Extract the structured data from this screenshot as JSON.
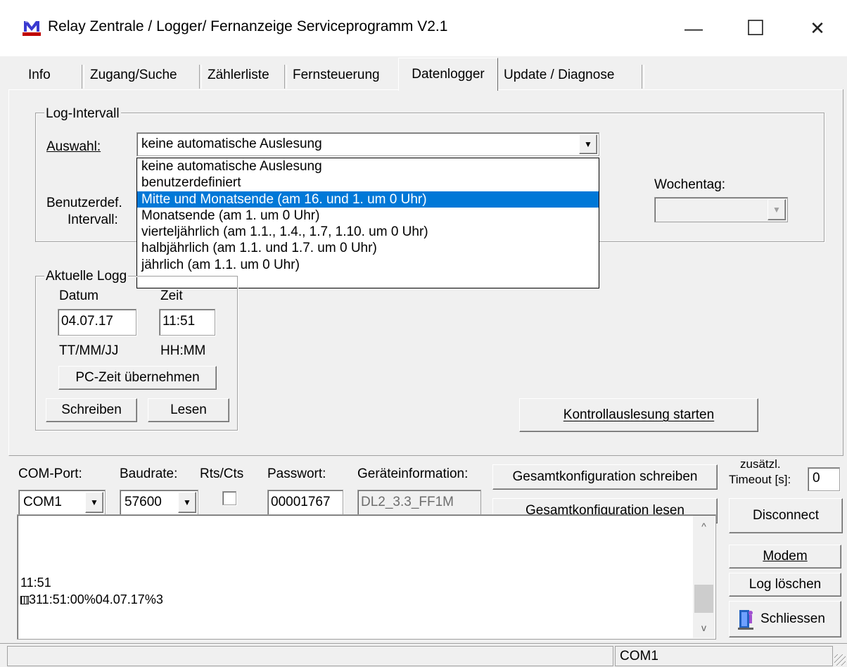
{
  "window": {
    "title": "Relay Zentrale / Logger/ Fernanzeige Serviceprogramm  V2.1",
    "minimize_glyph": "—",
    "maximize_glyph": "☐",
    "close_glyph": "✕",
    "app_icon": "relay-app-icon"
  },
  "tabs": [
    {
      "label": "Info"
    },
    {
      "label": "Zugang/Suche"
    },
    {
      "label": "Zählerliste"
    },
    {
      "label": "Fernsteuerung"
    },
    {
      "label": "Datenlogger"
    },
    {
      "label": "Update / Diagnose"
    }
  ],
  "log_interval": {
    "group_label": "Log-Intervall",
    "auswahl_label": "Auswahl:",
    "selected_value": "keine automatische Auslesung",
    "options": [
      "keine automatische Auslesung",
      "benutzerdefiniert",
      "Mitte und Monatsende (am 16. und 1. um 0 Uhr)",
      "Monatsende (am 1. um 0 Uhr)",
      "vierteljährlich (am 1.1., 1.4., 1.7, 1.10. um 0 Uhr)",
      "halbjährlich (am 1.1. und 1.7. um 0 Uhr)",
      "jährlich (am 1.1. um 0 Uhr)"
    ],
    "highlighted_index": 2,
    "benutzerdef_label_1": "Benutzerdef.",
    "benutzerdef_label_2": "Intervall:",
    "wochentag_label": "Wochentag:",
    "wochentag_value": ""
  },
  "logger_time": {
    "group_label": "Aktuelle Logg",
    "datum_label": "Datum",
    "zeit_label": "Zeit",
    "datum_value": "04.07.17",
    "zeit_value": "11:51",
    "datum_format": "TT/MM/JJ",
    "zeit_format": "HH:MM",
    "pc_time_button": "PC-Zeit übernehmen",
    "write_button": "Schreiben",
    "read_button": "Lesen"
  },
  "kontroll_button": "Kontrollauslesung starten",
  "connection": {
    "com_port_label": "COM-Port:",
    "com_port_value": "COM1",
    "baudrate_label": "Baudrate:",
    "baudrate_value": "57600",
    "rtscts_label": "Rts/Cts",
    "rtscts_checked": false,
    "password_label": "Passwort:",
    "password_value": "00001767",
    "device_info_label": "Geräteinformation:",
    "device_info_value": "DL2_3.3_FF1M",
    "write_all_button": "Gesamtkonfiguration schreiben",
    "read_all_button": "Gesamtkonfiguration lesen",
    "timeout_label_1": "zusätzl.",
    "timeout_label_2": "Timeout [s]:",
    "timeout_value": "0",
    "disconnect_button": "Disconnect"
  },
  "log": {
    "lines": [
      "11:51",
      "311:51:00%04.07.17%3"
    ]
  },
  "side_buttons": {
    "modem": "Modem",
    "clear_log": "Log löschen",
    "close": "Schliessen"
  },
  "statusbar": {
    "pane1": "",
    "pane2": "COM1"
  }
}
